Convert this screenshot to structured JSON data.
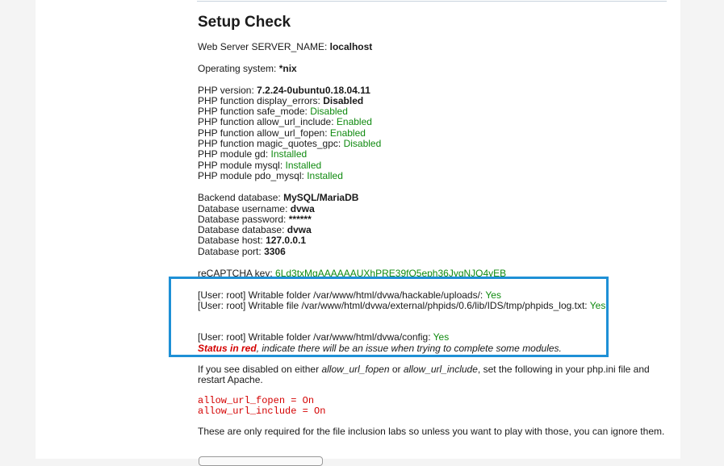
{
  "title": "Setup Check",
  "server": {
    "label": "Web Server SERVER_NAME: ",
    "value": "localhost"
  },
  "os": {
    "label": "Operating system: ",
    "value": "*nix"
  },
  "php": [
    {
      "label": "PHP version: ",
      "value": "7.2.24-0ubuntu0.18.04.11",
      "style": "bold"
    },
    {
      "label": "PHP function display_errors: ",
      "value": "Disabled",
      "style": "bold"
    },
    {
      "label": "PHP function safe_mode: ",
      "value": "Disabled",
      "style": "ok"
    },
    {
      "label": "PHP function allow_url_include: ",
      "value": "Enabled",
      "style": "ok"
    },
    {
      "label": "PHP function allow_url_fopen: ",
      "value": "Enabled",
      "style": "ok"
    },
    {
      "label": "PHP function magic_quotes_gpc: ",
      "value": "Disabled",
      "style": "ok"
    },
    {
      "label": "PHP module gd: ",
      "value": "Installed",
      "style": "ok"
    },
    {
      "label": "PHP module mysql: ",
      "value": "Installed",
      "style": "ok"
    },
    {
      "label": "PHP module pdo_mysql: ",
      "value": "Installed",
      "style": "ok"
    }
  ],
  "db": [
    {
      "label": "Backend database: ",
      "value": "MySQL/MariaDB"
    },
    {
      "label": "Database username: ",
      "value": "dvwa"
    },
    {
      "label": "Database password: ",
      "value": "******"
    },
    {
      "label": "Database database: ",
      "value": "dvwa"
    },
    {
      "label": "Database host: ",
      "value": "127.0.0.1"
    },
    {
      "label": "Database port: ",
      "value": "3306"
    }
  ],
  "recaptcha": {
    "label": "reCAPTCHA key: ",
    "value": "6Ld3txMgAAAAAAUXhPRE39fO5eph36JygNJQ4yEB"
  },
  "writable": [
    {
      "label": "[User: root] Writable folder /var/www/html/dvwa/hackable/uploads/: ",
      "value": "Yes"
    },
    {
      "label": "[User: root] Writable file /var/www/html/dvwa/external/phpids/0.6/lib/IDS/tmp/phpids_log.txt: ",
      "value": "Yes"
    }
  ],
  "config_writable": {
    "label": "[User: root] Writable folder /var/www/html/dvwa/config: ",
    "value": "Yes"
  },
  "status_note": {
    "red": "Status in red",
    "rest": ", indicate there will be an issue when trying to complete some modules."
  },
  "disabled_note": {
    "part1": "If you see disabled on either ",
    "fopen": "allow_url_fopen",
    "part2": " or ",
    "include": "allow_url_include",
    "part3": ", set the following in your php.ini file and restart Apache."
  },
  "code_lines": [
    "allow_url_fopen = On",
    "allow_url_include = On"
  ],
  "footer_note": "These are only required for the file inclusion labs so unless you want to play with those, you can ignore them.",
  "colors": {
    "ok": "#0f8a0f",
    "error": "#d40000",
    "highlight": "#1e90d6"
  }
}
